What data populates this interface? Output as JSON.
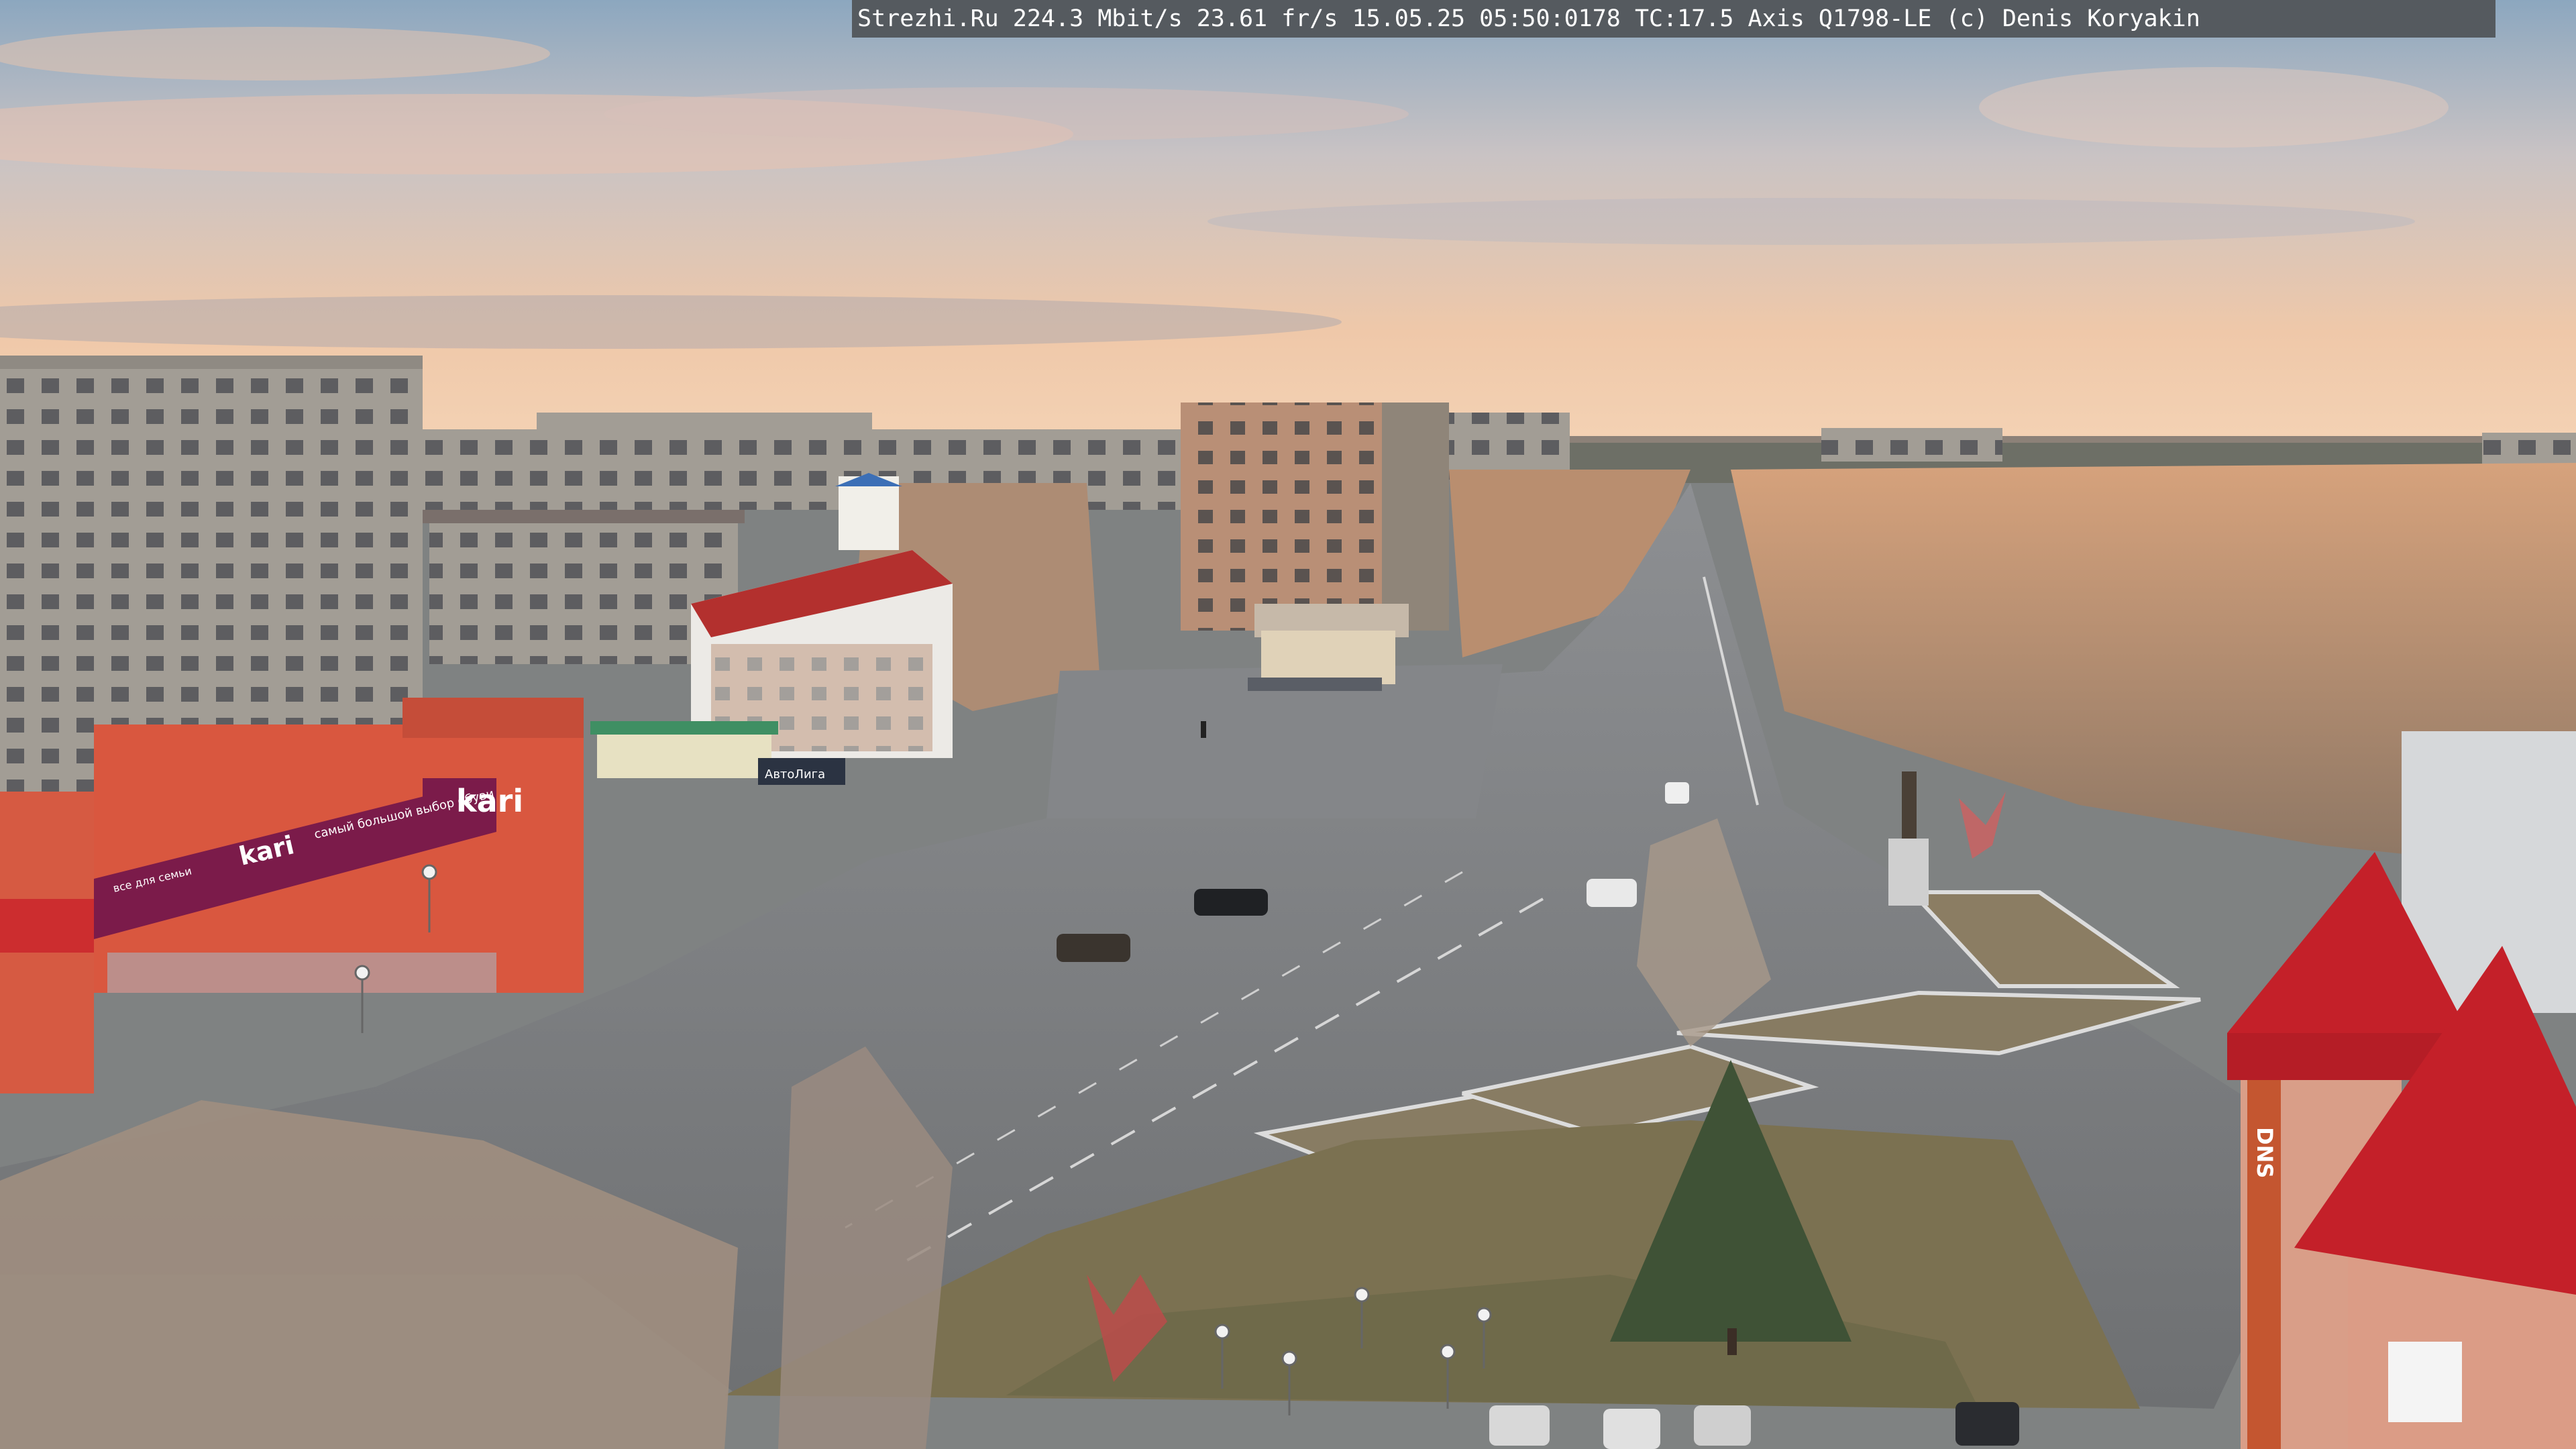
{
  "camera": {
    "overlay_text": "Strezhi.Ru 224.3 Mbit/s 23.61 fr/s 15.05.25 05:50:0178 TC:17.5  Axis Q1798-LE  (c) Denis Koryakin"
  },
  "signage": {
    "store_logo": "kari",
    "store_logo_small": "kari",
    "storefront_slogan": "самый большой выбор обуви",
    "storefront_slogan_2": "все для семьи",
    "shop_sign": "АвтоЛига",
    "dns_sign": "DNS"
  },
  "colors": {
    "sky_top": "#8aa6bf",
    "sky_horizon": "#f3c9a6",
    "road": "#7a7c7e",
    "panel_buildings": "#a19b92",
    "kari_facade": "#d9573f",
    "kari_banner": "#7b1b4a",
    "roof_red": "#c42029",
    "trees_warm": "#c99a73"
  }
}
